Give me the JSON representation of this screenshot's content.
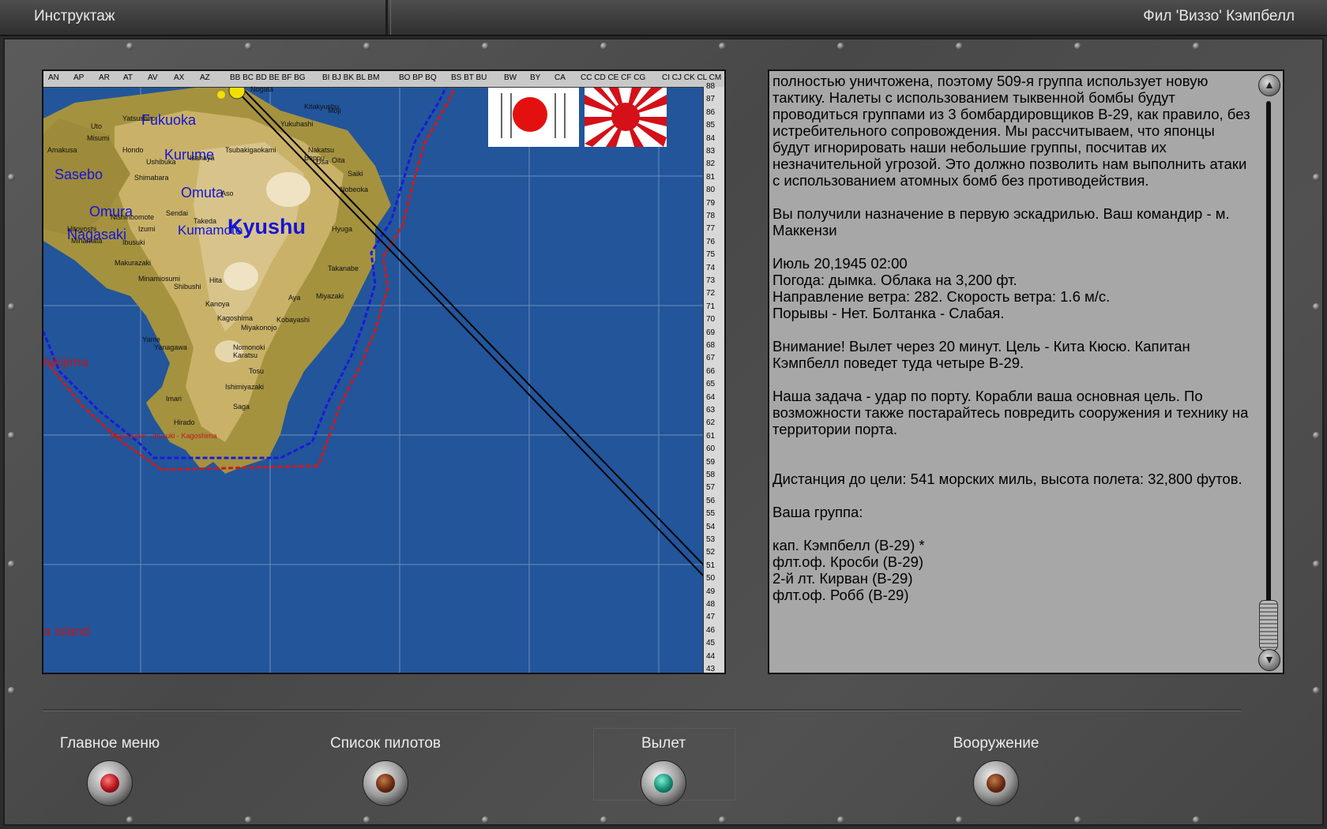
{
  "titlebar": {
    "screen_title": "Инструктаж",
    "pilot_name": "Фил 'Виззо' Кэмпбелл"
  },
  "map": {
    "col_labels": [
      "AN",
      "AP",
      "AR",
      "AT",
      "AV",
      "AX",
      "AZ",
      "BB BC BD BE BF BG",
      "BI  BJ BK BL BM",
      "BO BP BQ",
      "BS BT BU",
      "BW",
      "BY",
      "CA",
      "CC CD CE CF CG",
      "CI  CJ CK CL CM"
    ],
    "row_labels": [
      "88",
      "87",
      "86",
      "85",
      "84",
      "83",
      "82",
      "81",
      "80",
      "79",
      "78",
      "77",
      "76",
      "75",
      "74",
      "73",
      "72",
      "71",
      "70",
      "69",
      "68",
      "67",
      "66",
      "65",
      "64",
      "63",
      "62",
      "61",
      "60",
      "59",
      "58",
      "57",
      "56",
      "55",
      "54",
      "53",
      "52",
      "51",
      "50",
      "49",
      "48",
      "47",
      "46",
      "45",
      "44",
      "43"
    ],
    "region_label": "Kyushu",
    "city_labels": [
      "Fukuoka",
      "Kurume",
      "Sasebo",
      "Omuta",
      "Omura",
      "Nagasaki",
      "Kumamoto"
    ],
    "small_labels": [
      "Nogata",
      "Kitakyushu",
      "Moji",
      "Yukuhashi",
      "Nakatsu",
      "Usa",
      "Beppu",
      "Oita",
      "Saiki",
      "Nobeoka",
      "Hyuga",
      "Takanabe",
      "Miyazaki",
      "Aya",
      "Kobayashi",
      "Miyakonojo",
      "Kagoshima",
      "Kanoya",
      "Shibushi",
      "Minamiosumi",
      "Makurazaki",
      "Ibusuki",
      "Nishinoomote",
      "Sendai",
      "Izumi",
      "Hitoyoshi",
      "Minamata",
      "Yatsushiro",
      "Uto",
      "Misumi",
      "Amakusa",
      "Hondo",
      "Ushibuka",
      "Shimabara",
      "Isahaya",
      "Tsubakigaokami",
      "Nomonoki",
      "Karatsu",
      "Imari",
      "Hirado",
      "Ishimiyazaki",
      "Saga",
      "Tosu",
      "Yame",
      "Yanagawa",
      "Hita",
      "Aso",
      "Takeda"
    ],
    "lower_left_labels": [
      "hikijima",
      "a island"
    ],
    "legend_text": "Makurazaki - Ibusuki - Kagoshima"
  },
  "briefing": {
    "text": "полностью уничтожена, поэтому 509-я группа использует новую тактику. Налеты с использованием тыквенной бомбы будут проводиться группами из 3 бомбардировщиков B-29, как правило, без истребительного сопровождения. Мы рассчитываем, что японцы будут игнорировать наши небольшие группы, посчитав их незначительной угрозой. Это должно позволить нам выполнить атаки с использованием атомных бомб без противодействия.\n\nВы получили назначение в первую эскадрилью. Ваш командир - м. Маккензи\n\nИюль 20,1945 02:00\nПогода: дымка. Облака на 3,200 фт.\nНаправление ветра: 282. Скорость ветра: 1.6 м/с.\nПорывы - Нет. Болтанка - Слабая.\n\nВнимание! Вылет через 20 минут. Цель - Кита Кюсю. Капитан Кэмпбелл поведет туда четыре B-29.\n\nНаша задача - удар по порту. Корабли ваша основная цель. По возможности также постарайтесь повредить сооружения и технику на территории порта.\n\n\nДистанция до цели: 541 морских миль, высота полета: 32,800 футов.\n\nВаша группа:\n\nкап. Кэмпбелл (B-29) *\nфлт.оф. Кросби (B-29)\n2-й лт. Кирван (B-29)\nфлт.оф. Робб (B-29)"
  },
  "buttons": {
    "main_menu": "Главное меню",
    "pilot_list": "Список пилотов",
    "takeoff": "Вылет",
    "armament": "Вооружение"
  },
  "colors": {
    "sea": "#22559a",
    "route_blue": "#1a1adc",
    "route_red": "#d41818",
    "lamp_red": "#b0121a",
    "lamp_brown": "#6a2a10",
    "lamp_green": "#138a74"
  }
}
